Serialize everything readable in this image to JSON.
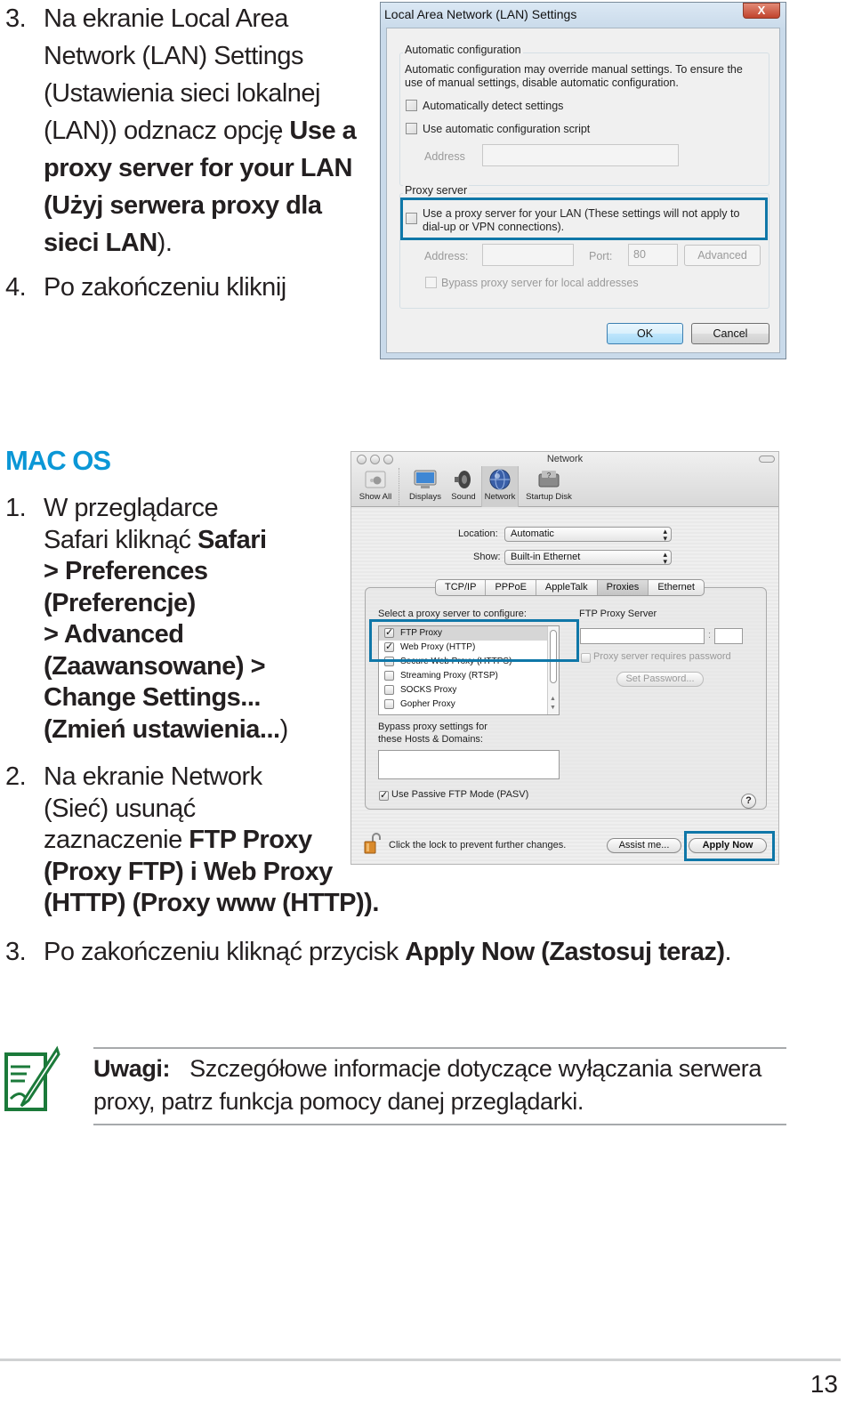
{
  "windows_steps": [
    {
      "num": "3.",
      "lines": [
        "Na ekranie Local Area",
        "Network (LAN) Settings",
        "(Ustawienia sieci lokalnej",
        "(LAN)) odznacz opcję ",
        "proxy server for your LAN",
        "(Użyj serwera proxy dla",
        "sieci LAN)."
      ],
      "bold_inline": "Use a"
    },
    {
      "num": "4.",
      "text": "Po zakończeniu kliknij"
    }
  ],
  "lan_dialog": {
    "title": "Local Area Network (LAN) Settings",
    "close_label": "X",
    "auto_config": {
      "group_label": "Automatic configuration",
      "description_line1": "Automatic configuration may override manual settings.  To ensure the",
      "description_line2": "use of manual settings, disable automatic configuration.",
      "auto_detect_label": "Automatically detect settings",
      "auto_detect_checked": false,
      "script_label": "Use automatic configuration script",
      "script_checked": false,
      "address_label": "Address",
      "address_value": ""
    },
    "proxy": {
      "group_label": "Proxy server",
      "use_proxy_line1": "Use a proxy server for your LAN (These settings will not apply to",
      "use_proxy_line2": "dial-up or VPN connections).",
      "use_proxy_checked": false,
      "address_label": "Address:",
      "address_value": "",
      "port_label": "Port:",
      "port_value": "80",
      "advanced_label": "Advanced",
      "bypass_label": "Bypass proxy server for local addresses",
      "bypass_checked": false
    },
    "ok_label": "OK",
    "cancel_label": "Cancel",
    "highlight_color": "#0f77a8"
  },
  "mac_section": {
    "title": "MAC OS",
    "title_color": "#0b97d6",
    "step1": {
      "num": "1.",
      "l1": "W przeglądarce",
      "l2a": "Safari kliknąć ",
      "l2b": "Safari",
      "l3": "> Preferences",
      "l4": "(Preferencje)",
      "l5": "> Advanced",
      "l6": "(Zaawansowane) >",
      "l7": "Change Settings...",
      "l8a": "(Zmień ustawienia...",
      "l8b": ")"
    },
    "step2": {
      "num": "2.",
      "l1": "Na ekranie Network",
      "l2": "(Sieć) usunąć",
      "l3a": "zaznaczenie ",
      "l3b": "FTP Proxy",
      "l4": "(Proxy FTP) i Web Proxy",
      "l5a": "(HTTP) (Proxy www (HTTP))",
      "l5b": "."
    },
    "step3": {
      "num": "3.",
      "a": "Po zakończeniu kliknąć przycisk ",
      "b": "Apply Now (Zastosuj teraz)",
      "c": "."
    }
  },
  "network_dialog": {
    "title": "Network",
    "toolbar": [
      {
        "label": "Show All",
        "icon": "apple-icon"
      },
      {
        "label": "Displays",
        "icon": "display-icon"
      },
      {
        "label": "Sound",
        "icon": "speaker-icon"
      },
      {
        "label": "Network",
        "icon": "globe-icon",
        "selected": true
      },
      {
        "label": "Startup Disk",
        "icon": "disk-icon"
      }
    ],
    "location_label": "Location:",
    "location_value": "Automatic",
    "show_label": "Show:",
    "show_value": "Built-in Ethernet",
    "tabs": [
      "TCP/IP",
      "PPPoE",
      "AppleTalk",
      "Proxies",
      "Ethernet"
    ],
    "selected_tab": "Proxies",
    "select_label": "Select a proxy server to configure:",
    "proxies": [
      {
        "label": "FTP Proxy",
        "checked": true
      },
      {
        "label": "Web Proxy (HTTP)",
        "checked": true
      },
      {
        "label": "Secure Web Proxy (HTTPS)",
        "checked": false
      },
      {
        "label": "Streaming Proxy (RTSP)",
        "checked": false
      },
      {
        "label": "SOCKS Proxy",
        "checked": false
      },
      {
        "label": "Gopher Proxy",
        "checked": false
      }
    ],
    "server_label": "FTP Proxy Server",
    "server_value": "",
    "port_sep": ":",
    "port_value": "",
    "requires_password_label": "Proxy server requires password",
    "requires_password_checked": false,
    "set_password_label": "Set Password...",
    "bypass_label_1": "Bypass proxy settings for",
    "bypass_label_2": "these Hosts & Domains:",
    "bypass_value": "",
    "passive_label": "Use Passive FTP Mode (PASV)",
    "passive_checked": true,
    "help_label": "?",
    "lock_text": "Click the lock to prevent further changes.",
    "assist_label": "Assist me...",
    "apply_label": "Apply Now"
  },
  "note": {
    "label": "Uwagi:",
    "text_line1": "Szczegółowe informacje dotyczące wyłączania serwera",
    "text_line2": "proxy, patrz funkcja pomocy danej przeglądarki.",
    "icon_color": "#1b7a3a"
  },
  "page_number": "13"
}
